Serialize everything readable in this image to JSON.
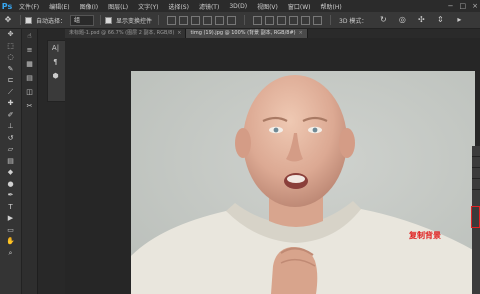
{
  "app": {
    "logo": "Ps"
  },
  "menu": [
    "文件(F)",
    "编辑(E)",
    "图像(I)",
    "图层(L)",
    "文字(Y)",
    "选择(S)",
    "滤镜(T)",
    "3D(D)",
    "视图(V)",
    "窗口(W)",
    "帮助(H)"
  ],
  "window_controls": [
    "−",
    "□",
    "×"
  ],
  "options": {
    "auto_select_label": "自动选择：",
    "auto_select_value": "组",
    "transform_label": "显示变换控件",
    "mode_3d": "3D 模式："
  },
  "tabs": [
    {
      "label": "未标题-1.psd @ 66.7% (图层 2 副本, RGB/8)",
      "active": false
    },
    {
      "label": "timg (19).jpg @ 100% (背景 副本, RGB/8#)",
      "active": true
    }
  ],
  "tools": [
    "move",
    "marquee",
    "lasso",
    "quick-select",
    "crop",
    "eyedropper",
    "heal",
    "brush",
    "stamp",
    "history-brush",
    "eraser",
    "gradient",
    "blur",
    "dodge",
    "pen",
    "type",
    "path-select",
    "shape",
    "hand",
    "zoom"
  ],
  "annotation": {
    "label": "复制背景"
  }
}
